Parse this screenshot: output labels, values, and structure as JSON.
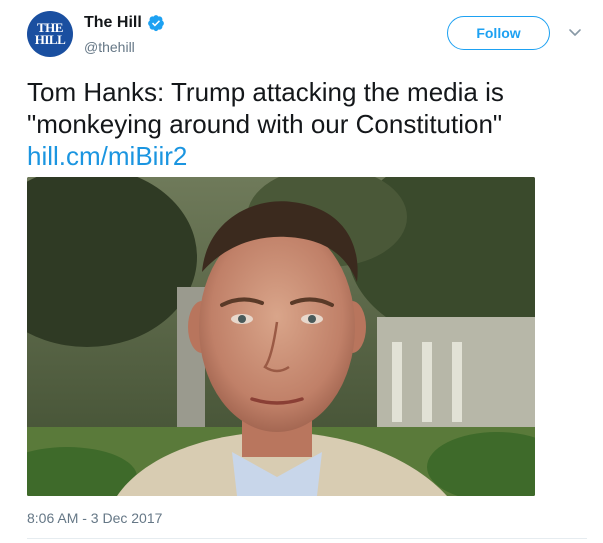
{
  "author": {
    "avatar_line1": "THE",
    "avatar_line2": "HILL",
    "display_name": "The Hill",
    "handle": "@thehill",
    "verified": true
  },
  "actions": {
    "follow_label": "Follow",
    "menu_icon": "chevron-down-icon"
  },
  "tweet": {
    "text_line1": "Tom Hanks: Trump attacking the media is",
    "text_line2": "\"monkeying around with our Constitution\"",
    "link": "hill.cm/miBiir2",
    "timestamp": "8:06 AM - 3 Dec 2017"
  },
  "colors": {
    "accent": "#1da1f2",
    "link": "#1b95e0",
    "secondary_text": "#657786",
    "avatar_bg": "#1a4fa0"
  }
}
